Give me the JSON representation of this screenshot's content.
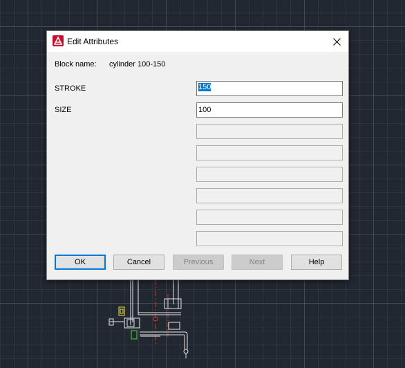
{
  "window": {
    "title": "Edit Attributes",
    "app_icon": "autocad-logo-icon",
    "close_icon": "close-icon"
  },
  "block": {
    "label": "Block name:",
    "value": "cylinder 100-150"
  },
  "attributes": [
    {
      "tag": "STROKE",
      "value": "150",
      "selected": true
    },
    {
      "tag": "SIZE",
      "value": "100",
      "selected": false
    },
    {
      "tag": "",
      "value": "",
      "disabled": true
    },
    {
      "tag": "",
      "value": "",
      "disabled": true
    },
    {
      "tag": "",
      "value": "",
      "disabled": true
    },
    {
      "tag": "",
      "value": "",
      "disabled": true
    },
    {
      "tag": "",
      "value": "",
      "disabled": true
    },
    {
      "tag": "",
      "value": "",
      "disabled": true
    }
  ],
  "buttons": {
    "ok": "OK",
    "cancel": "Cancel",
    "previous": "Previous",
    "next": "Next",
    "help": "Help"
  },
  "colors": {
    "canvas_background": "#212830",
    "accent": "#0078d7",
    "autocad_red": "#c8102e"
  }
}
